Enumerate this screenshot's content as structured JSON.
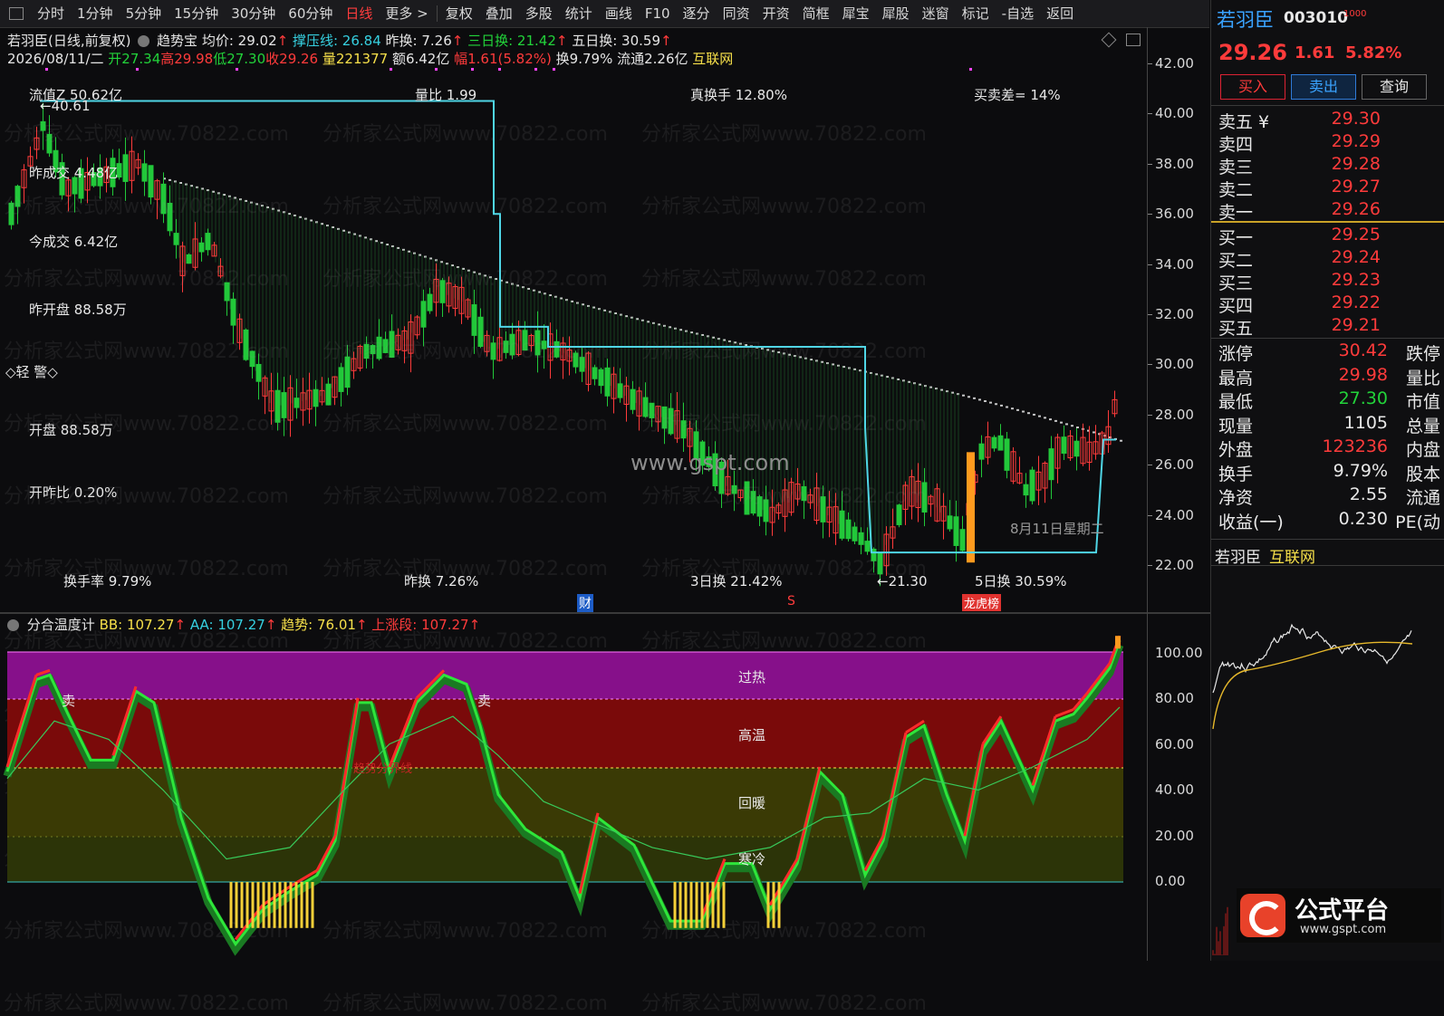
{
  "toolbar": {
    "items": [
      "分时",
      "1分钟",
      "5分钟",
      "15分钟",
      "30分钟",
      "60分钟",
      "日线",
      "更多 >",
      "复权",
      "叠加",
      "多股",
      "统计",
      "画线",
      "F10",
      "逐分",
      "同资",
      "开资",
      "简框",
      "犀宝",
      "犀股",
      "迷窗",
      "标记",
      "-自选",
      "返回"
    ],
    "active_index": 6
  },
  "header": {
    "title": "若羽臣(日线,前复权)",
    "indicator": "趋势宝",
    "avg_price": "均价: 29.02",
    "pressure": "撑压线: 26.84",
    "prev_turnover": "昨换: 7.26",
    "three_day": "三日换: 21.42",
    "five_day": "五日换: 30.59",
    "date": "2026/08/11/二",
    "open": "开27.34",
    "high": "高29.98",
    "low": "低27.30",
    "close": "收29.26",
    "volume": "量221377",
    "amount": "额6.42亿",
    "change": "幅1.61(5.82%)",
    "turnover": "换9.79%",
    "float_cap": "流通2.26亿",
    "concept": "互联网"
  },
  "main_labels": {
    "float_value": "流值Z 50.62亿",
    "vol_ratio": "量比 1.99",
    "real_turnover": "真换手 12.80%",
    "bid_ask_diff": "买卖差= 14%",
    "high_marker": "40.61",
    "low_marker": "21.30",
    "yest_amount": "昨成交 4.48亿",
    "today_amount": "今成交 6.42亿",
    "yest_open": "昨开盘 88.58万",
    "alert": "◇轻 警◇",
    "open_amt": "开盘 88.58万",
    "open_ratio": "开昨比 0.20%",
    "turnover_rate": "换手率 9.79%",
    "prev_turn": "昨换 7.26%",
    "three_turn": "3日换 21.42%",
    "five_turn": "5日换 30.59%",
    "date_tag": "8月11日星期二",
    "cai_tag": "财",
    "s_tag": "S",
    "lhb_tag": "龙虎榜",
    "watermark_center": "www.gspt.com",
    "watermark_repeat": "分析家公式网www.70822.com"
  },
  "main_yaxis": [
    "42.00",
    "40.00",
    "38.00",
    "36.00",
    "34.00",
    "32.00",
    "30.00",
    "28.00",
    "26.00",
    "24.00",
    "22.00"
  ],
  "sub": {
    "title": "分合温度计",
    "bb": "BB: 107.27",
    "aa": "AA: 107.27",
    "trend": "趋势: 76.01",
    "up_seg": "上涨段: 107.27",
    "zones": [
      "过热",
      "高温",
      "回暖",
      "寒冷"
    ],
    "sell_marks": [
      "卖",
      "卖"
    ],
    "faint_label": "趋势分界线",
    "yaxis": [
      "100.00",
      "80.00",
      "60.00",
      "40.00",
      "20.00",
      "0.00"
    ]
  },
  "quote": {
    "name": "若羽臣",
    "code": "003010",
    "price": "29.26",
    "change": "1.61",
    "pct": "5.82%",
    "buttons": [
      "买入",
      "卖出",
      "查询"
    ],
    "asks": [
      {
        "label": "卖五 ¥",
        "price": "29.30"
      },
      {
        "label": "卖四",
        "price": "29.29"
      },
      {
        "label": "卖三",
        "price": "29.28"
      },
      {
        "label": "卖二",
        "price": "29.27"
      },
      {
        "label": "卖一",
        "price": "29.26"
      }
    ],
    "bids": [
      {
        "label": "买一",
        "price": "29.25"
      },
      {
        "label": "买二",
        "price": "29.24"
      },
      {
        "label": "买三",
        "price": "29.23"
      },
      {
        "label": "买四",
        "price": "29.22"
      },
      {
        "label": "买五",
        "price": "29.21"
      }
    ],
    "stats": [
      {
        "k": "涨停",
        "v": "30.42",
        "k2": "跌停",
        "color": "#ff3b3b"
      },
      {
        "k": "最高",
        "v": "29.98",
        "k2": "量比",
        "color": "#ff3b3b"
      },
      {
        "k": "最低",
        "v": "27.30",
        "k2": "市值",
        "color": "#22d33a"
      },
      {
        "k": "现量",
        "v": "1105",
        "k2": "总量",
        "color": "#e8e8e8"
      },
      {
        "k": "外盘",
        "v": "123236",
        "k2": "内盘",
        "color": "#ff3b3b"
      },
      {
        "k": "换手",
        "v": "9.79%",
        "k2": "股本",
        "color": "#e8e8e8"
      },
      {
        "k": "净资",
        "v": "2.55",
        "k2": "流通",
        "color": "#e8e8e8"
      },
      {
        "k": "收益(一)",
        "v": "0.230",
        "k2": "PE(动",
        "color": "#e8e8e8"
      }
    ],
    "mini_name": "若羽臣",
    "mini_concept": "互联网",
    "logo_text": "公式平台",
    "logo_url": "www.gspt.com"
  }
}
